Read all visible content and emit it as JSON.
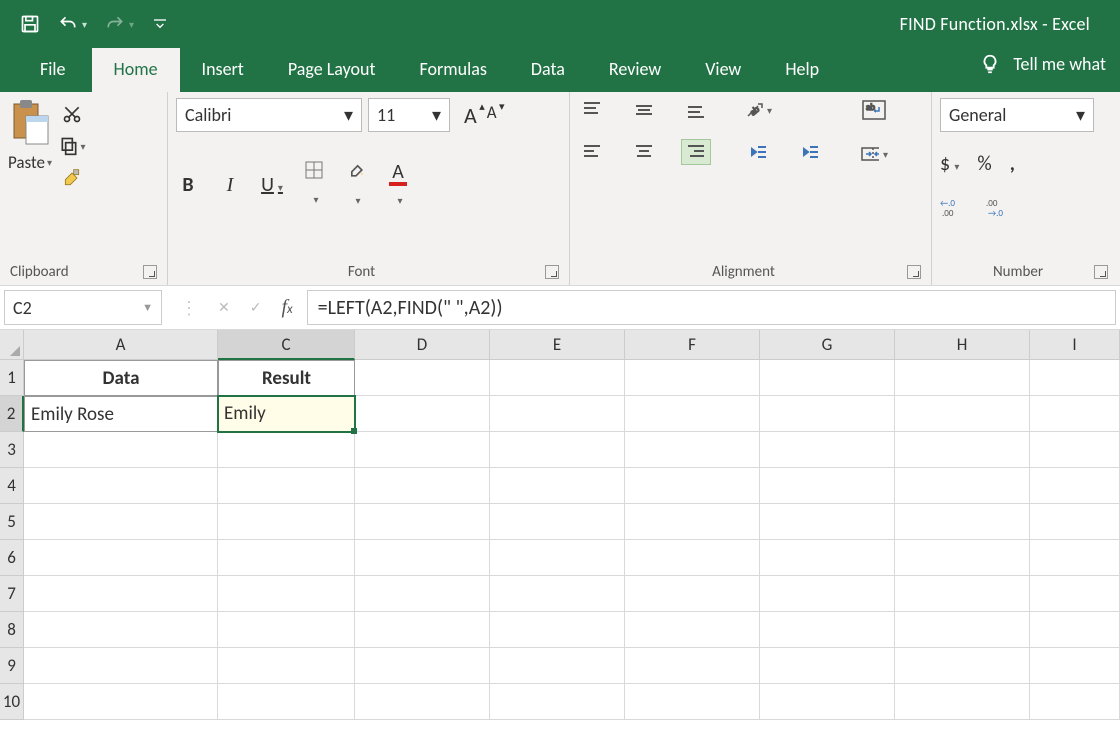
{
  "titlebar": {
    "title": "FIND Function.xlsx  -  Excel"
  },
  "tabs": {
    "file": "File",
    "home": "Home",
    "insert": "Insert",
    "page_layout": "Page Layout",
    "formulas": "Formulas",
    "data": "Data",
    "review": "Review",
    "view": "View",
    "help": "Help",
    "tellme": "Tell me what"
  },
  "ribbon": {
    "clipboard": {
      "paste": "Paste",
      "label": "Clipboard"
    },
    "font": {
      "name": "Calibri",
      "size": "11",
      "label": "Font"
    },
    "alignment": {
      "label": "Alignment"
    },
    "number": {
      "format": "General",
      "label": "Number"
    }
  },
  "namebox": "C2",
  "formula": "=LEFT(A2,FIND(\" \",A2))",
  "columns": [
    "A",
    "C",
    "D",
    "E",
    "F",
    "G",
    "H",
    "I"
  ],
  "rows": [
    "1",
    "2",
    "3",
    "4",
    "5",
    "6",
    "7",
    "8",
    "9",
    "10"
  ],
  "cells": {
    "A1": "Data",
    "C1": "Result",
    "A2": "Emily Rose",
    "C2": "Emily "
  },
  "selected_cell": "C2"
}
